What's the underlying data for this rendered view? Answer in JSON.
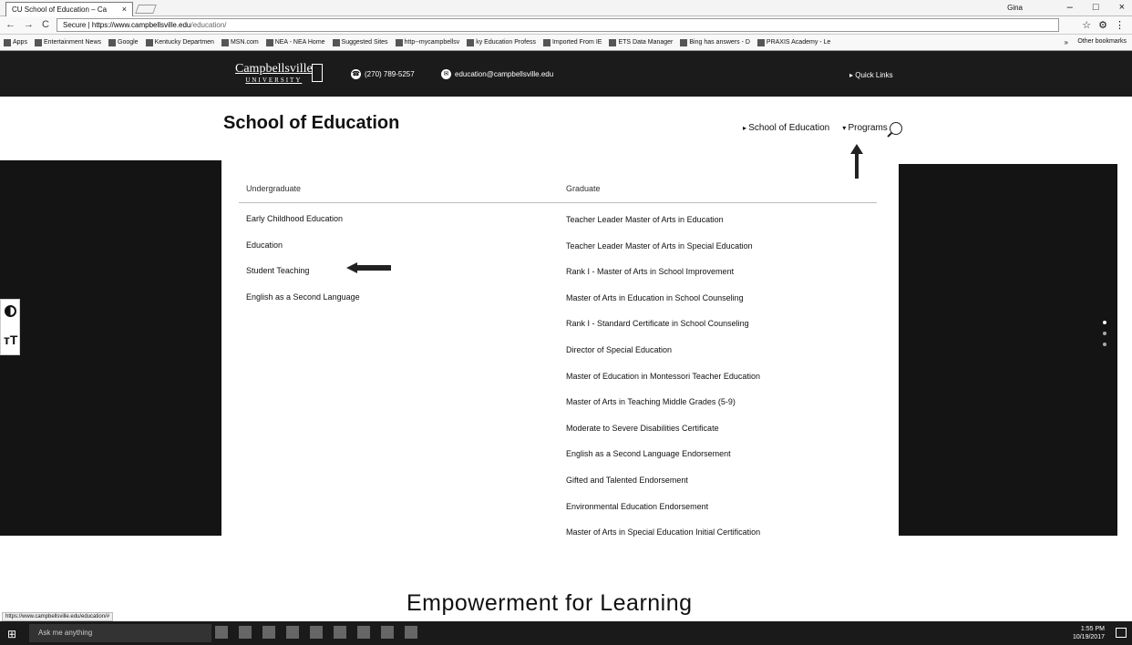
{
  "browser": {
    "tab_title": "CU School of Education – Ca",
    "tab_close": "×",
    "user_label": "Gina",
    "window_controls": [
      "–",
      "□",
      "×"
    ],
    "nav_buttons": [
      "←",
      "→",
      "C"
    ],
    "secure_label": "Secure",
    "url_host": "https://www.campbellsville.edu",
    "url_path": "/education/",
    "addr_icons": [
      "☆",
      "⚙",
      "⋮"
    ],
    "bookmarks": [
      "Apps",
      "Entertainment News",
      "Google",
      "Kentucky Departmen",
      "MSN.com",
      "NEA - NEA Home",
      "Suggested Sites",
      "http--mycampbellsv",
      "ky Education Profess",
      "Imported From IE",
      "ETS Data Manager",
      "Bing has answers - D",
      "PRAXIS Academy - Le"
    ],
    "bookmarks_more": "»",
    "other_bookmarks": "Other bookmarks"
  },
  "header": {
    "logo_text": "Campbellsville",
    "logo_sub": "UNIVERSITY",
    "phone": "(270) 789-5257",
    "email": "education@campbellsville.edu",
    "quick_links": "Quick Links"
  },
  "page": {
    "title": "School of Education",
    "nav_school": "School of Education",
    "nav_programs": "Programs",
    "hero_text": "Empowerment for Learning",
    "status_url": "https://www.campbellsville.edu/education/#"
  },
  "programs": {
    "undergraduate_label": "Undergraduate",
    "graduate_label": "Graduate",
    "undergraduate": [
      "Early Childhood Education",
      "Education",
      "Student Teaching",
      "English as a Second Language"
    ],
    "graduate": [
      "Teacher Leader Master of Arts in Education",
      "Teacher Leader Master of Arts in Special Education",
      "Rank I - Master of Arts in School Improvement",
      "Master of Arts in Education in School Counseling",
      "Rank I - Standard Certificate in School Counseling",
      "Director of Special Education",
      "Master of Education in Montessori Teacher Education",
      "Master of Arts in Teaching Middle Grades (5-9)",
      "Moderate to Severe Disabilities Certificate",
      "English as a Second Language Endorsement",
      "Gifted and Talented Endorsement",
      "Environmental Education Endorsement",
      "Master of Arts in Special Education Initial Certification"
    ]
  },
  "taskbar": {
    "start_icon": "⊞",
    "search_placeholder": "Ask me anything",
    "time": "1:55 PM",
    "date": "10/19/2017"
  }
}
